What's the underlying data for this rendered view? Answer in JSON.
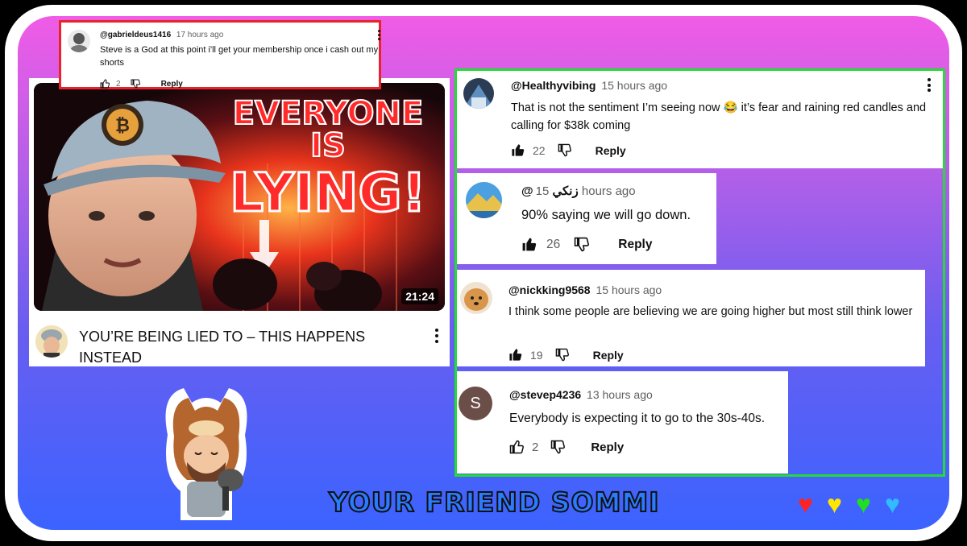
{
  "top_comment": {
    "handle": "@gabrieldeus1416",
    "time": "17 hours ago",
    "text": "Steve is a God at this point i'll get your membership once i cash out my shorts",
    "likes": "2",
    "reply_label": "Reply"
  },
  "video": {
    "thumbnail_text_line1": "EVERYONE IS",
    "thumbnail_text_line2": "LYING!",
    "duration": "21:24",
    "title": "YOU’RE BEING LIED TO  – THIS HAPPENS INSTEAD"
  },
  "comments": [
    {
      "handle": "@Healthyvibing",
      "time": "15 hours ago",
      "text": "That is not the sentiment I’m seeing now 😂 it’s fear and raining red candles and calling for $38k coming",
      "likes": "22",
      "reply_label": "Reply"
    },
    {
      "handle": "@زنكي",
      "time": "15 hours ago",
      "text": "90% saying we will go down.",
      "likes": "26",
      "reply_label": "Reply"
    },
    {
      "handle": "@nickking9568",
      "time": "15 hours ago",
      "text": "I think some people are believing we are going higher but most still think lower",
      "likes": "19",
      "reply_label": "Reply"
    },
    {
      "handle": "@stevep4236",
      "time": "13 hours ago",
      "text": "Everybody is expecting it to go to the 30s-40s.",
      "likes": "2",
      "reply_label": "Reply",
      "avatar_letter": "S"
    }
  ],
  "branding": {
    "text": "YOUR FRIEND SOMMI",
    "heart_colors": [
      "#ff2222",
      "#ffe600",
      "#22dd22",
      "#33bbff"
    ]
  },
  "colors": {
    "top_comment_border": "#e8242a",
    "comments_group_border": "#22dd33"
  }
}
